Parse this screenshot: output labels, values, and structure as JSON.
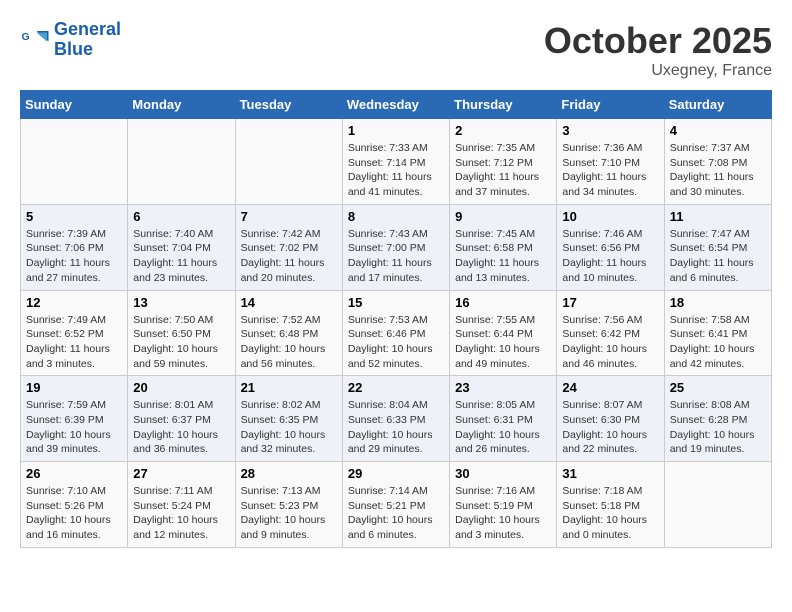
{
  "header": {
    "logo_line1": "General",
    "logo_line2": "Blue",
    "month_title": "October 2025",
    "location": "Uxegney, France"
  },
  "days_of_week": [
    "Sunday",
    "Monday",
    "Tuesday",
    "Wednesday",
    "Thursday",
    "Friday",
    "Saturday"
  ],
  "weeks": [
    [
      {
        "day": "",
        "info": ""
      },
      {
        "day": "",
        "info": ""
      },
      {
        "day": "",
        "info": ""
      },
      {
        "day": "1",
        "info": "Sunrise: 7:33 AM\nSunset: 7:14 PM\nDaylight: 11 hours\nand 41 minutes."
      },
      {
        "day": "2",
        "info": "Sunrise: 7:35 AM\nSunset: 7:12 PM\nDaylight: 11 hours\nand 37 minutes."
      },
      {
        "day": "3",
        "info": "Sunrise: 7:36 AM\nSunset: 7:10 PM\nDaylight: 11 hours\nand 34 minutes."
      },
      {
        "day": "4",
        "info": "Sunrise: 7:37 AM\nSunset: 7:08 PM\nDaylight: 11 hours\nand 30 minutes."
      }
    ],
    [
      {
        "day": "5",
        "info": "Sunrise: 7:39 AM\nSunset: 7:06 PM\nDaylight: 11 hours\nand 27 minutes."
      },
      {
        "day": "6",
        "info": "Sunrise: 7:40 AM\nSunset: 7:04 PM\nDaylight: 11 hours\nand 23 minutes."
      },
      {
        "day": "7",
        "info": "Sunrise: 7:42 AM\nSunset: 7:02 PM\nDaylight: 11 hours\nand 20 minutes."
      },
      {
        "day": "8",
        "info": "Sunrise: 7:43 AM\nSunset: 7:00 PM\nDaylight: 11 hours\nand 17 minutes."
      },
      {
        "day": "9",
        "info": "Sunrise: 7:45 AM\nSunset: 6:58 PM\nDaylight: 11 hours\nand 13 minutes."
      },
      {
        "day": "10",
        "info": "Sunrise: 7:46 AM\nSunset: 6:56 PM\nDaylight: 11 hours\nand 10 minutes."
      },
      {
        "day": "11",
        "info": "Sunrise: 7:47 AM\nSunset: 6:54 PM\nDaylight: 11 hours\nand 6 minutes."
      }
    ],
    [
      {
        "day": "12",
        "info": "Sunrise: 7:49 AM\nSunset: 6:52 PM\nDaylight: 11 hours\nand 3 minutes."
      },
      {
        "day": "13",
        "info": "Sunrise: 7:50 AM\nSunset: 6:50 PM\nDaylight: 10 hours\nand 59 minutes."
      },
      {
        "day": "14",
        "info": "Sunrise: 7:52 AM\nSunset: 6:48 PM\nDaylight: 10 hours\nand 56 minutes."
      },
      {
        "day": "15",
        "info": "Sunrise: 7:53 AM\nSunset: 6:46 PM\nDaylight: 10 hours\nand 52 minutes."
      },
      {
        "day": "16",
        "info": "Sunrise: 7:55 AM\nSunset: 6:44 PM\nDaylight: 10 hours\nand 49 minutes."
      },
      {
        "day": "17",
        "info": "Sunrise: 7:56 AM\nSunset: 6:42 PM\nDaylight: 10 hours\nand 46 minutes."
      },
      {
        "day": "18",
        "info": "Sunrise: 7:58 AM\nSunset: 6:41 PM\nDaylight: 10 hours\nand 42 minutes."
      }
    ],
    [
      {
        "day": "19",
        "info": "Sunrise: 7:59 AM\nSunset: 6:39 PM\nDaylight: 10 hours\nand 39 minutes."
      },
      {
        "day": "20",
        "info": "Sunrise: 8:01 AM\nSunset: 6:37 PM\nDaylight: 10 hours\nand 36 minutes."
      },
      {
        "day": "21",
        "info": "Sunrise: 8:02 AM\nSunset: 6:35 PM\nDaylight: 10 hours\nand 32 minutes."
      },
      {
        "day": "22",
        "info": "Sunrise: 8:04 AM\nSunset: 6:33 PM\nDaylight: 10 hours\nand 29 minutes."
      },
      {
        "day": "23",
        "info": "Sunrise: 8:05 AM\nSunset: 6:31 PM\nDaylight: 10 hours\nand 26 minutes."
      },
      {
        "day": "24",
        "info": "Sunrise: 8:07 AM\nSunset: 6:30 PM\nDaylight: 10 hours\nand 22 minutes."
      },
      {
        "day": "25",
        "info": "Sunrise: 8:08 AM\nSunset: 6:28 PM\nDaylight: 10 hours\nand 19 minutes."
      }
    ],
    [
      {
        "day": "26",
        "info": "Sunrise: 7:10 AM\nSunset: 5:26 PM\nDaylight: 10 hours\nand 16 minutes."
      },
      {
        "day": "27",
        "info": "Sunrise: 7:11 AM\nSunset: 5:24 PM\nDaylight: 10 hours\nand 12 minutes."
      },
      {
        "day": "28",
        "info": "Sunrise: 7:13 AM\nSunset: 5:23 PM\nDaylight: 10 hours\nand 9 minutes."
      },
      {
        "day": "29",
        "info": "Sunrise: 7:14 AM\nSunset: 5:21 PM\nDaylight: 10 hours\nand 6 minutes."
      },
      {
        "day": "30",
        "info": "Sunrise: 7:16 AM\nSunset: 5:19 PM\nDaylight: 10 hours\nand 3 minutes."
      },
      {
        "day": "31",
        "info": "Sunrise: 7:18 AM\nSunset: 5:18 PM\nDaylight: 10 hours\nand 0 minutes."
      },
      {
        "day": "",
        "info": ""
      }
    ]
  ]
}
